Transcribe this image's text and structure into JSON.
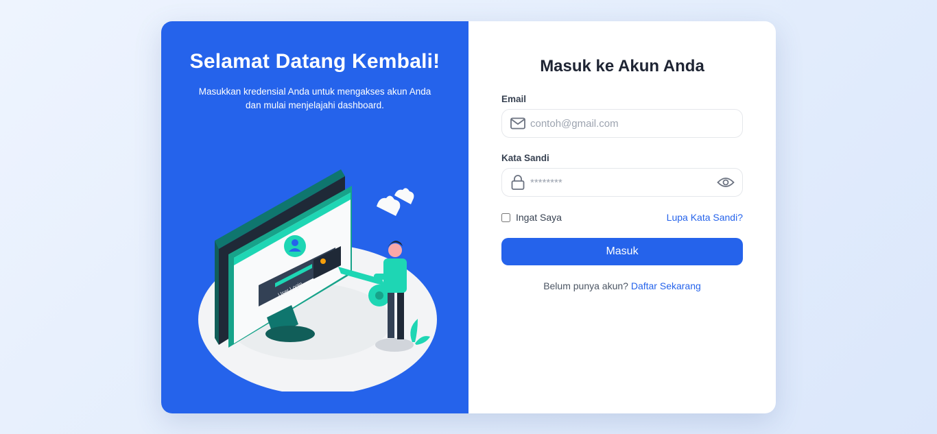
{
  "left_panel": {
    "title": "Selamat Datang Kembali!",
    "subtitle": "Masukkan kredensial Anda untuk mengakses akun Anda dan mulai menjelajahi dashboard.",
    "illustration_label": "User Login",
    "accent_color": "#2563eb",
    "illustration_accent": "#1ed6b4"
  },
  "login_form": {
    "title": "Masuk ke Akun Anda",
    "email_label": "Email",
    "email_placeholder": "contoh@gmail.com",
    "email_icon": "mail-icon",
    "password_label": "Kata Sandi",
    "password_placeholder": "********",
    "password_icon": "lock-icon",
    "toggle_icon": "eye-icon",
    "remember_label": "Ingat Saya",
    "remember_checked": false,
    "forgot_link": "Lupa Kata Sandi?",
    "submit_label": "Masuk",
    "signup_prompt": "Belum punya akun?",
    "signup_link": "Daftar Sekarang"
  }
}
